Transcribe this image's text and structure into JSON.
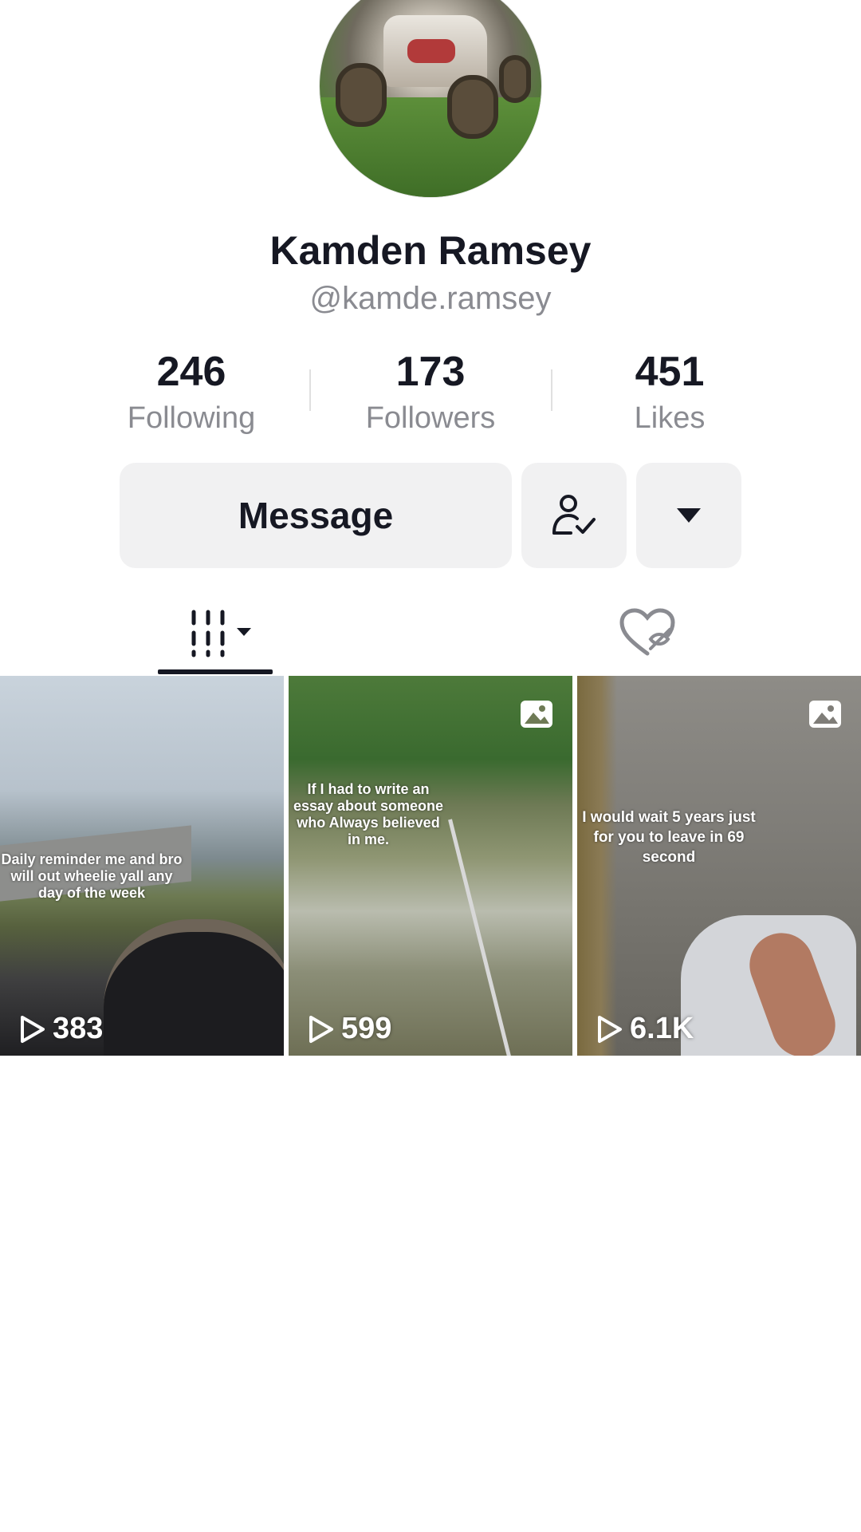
{
  "profile": {
    "name": "Kamden Ramsey",
    "handle": "@kamde.ramsey"
  },
  "stats": {
    "following": {
      "value": "246",
      "label": "Following"
    },
    "followers": {
      "value": "173",
      "label": "Followers"
    },
    "likes": {
      "value": "451",
      "label": "Likes"
    }
  },
  "actions": {
    "message_label": "Message",
    "friend_icon": "person-check-icon",
    "more_icon": "caret-down-icon"
  },
  "tabs": [
    {
      "name": "videos",
      "icon": "grid-lines-icon",
      "selected": true
    },
    {
      "name": "liked",
      "icon": "hidden-heart-icon",
      "selected": false
    }
  ],
  "videos": [
    {
      "caption": "Daily reminder me and bro will out wheelie yall any day of the week",
      "views": "383",
      "photo": false
    },
    {
      "caption": "If I had to write an essay about someone who Always believed in me.",
      "views": "599",
      "photo": true
    },
    {
      "caption": "I would wait 5 years just for you to leave in 69 second",
      "views": "6.1K",
      "photo": true
    }
  ],
  "colors": {
    "text_primary": "#161823",
    "text_secondary": "#8a8b91",
    "button_bg": "#f1f1f2"
  }
}
